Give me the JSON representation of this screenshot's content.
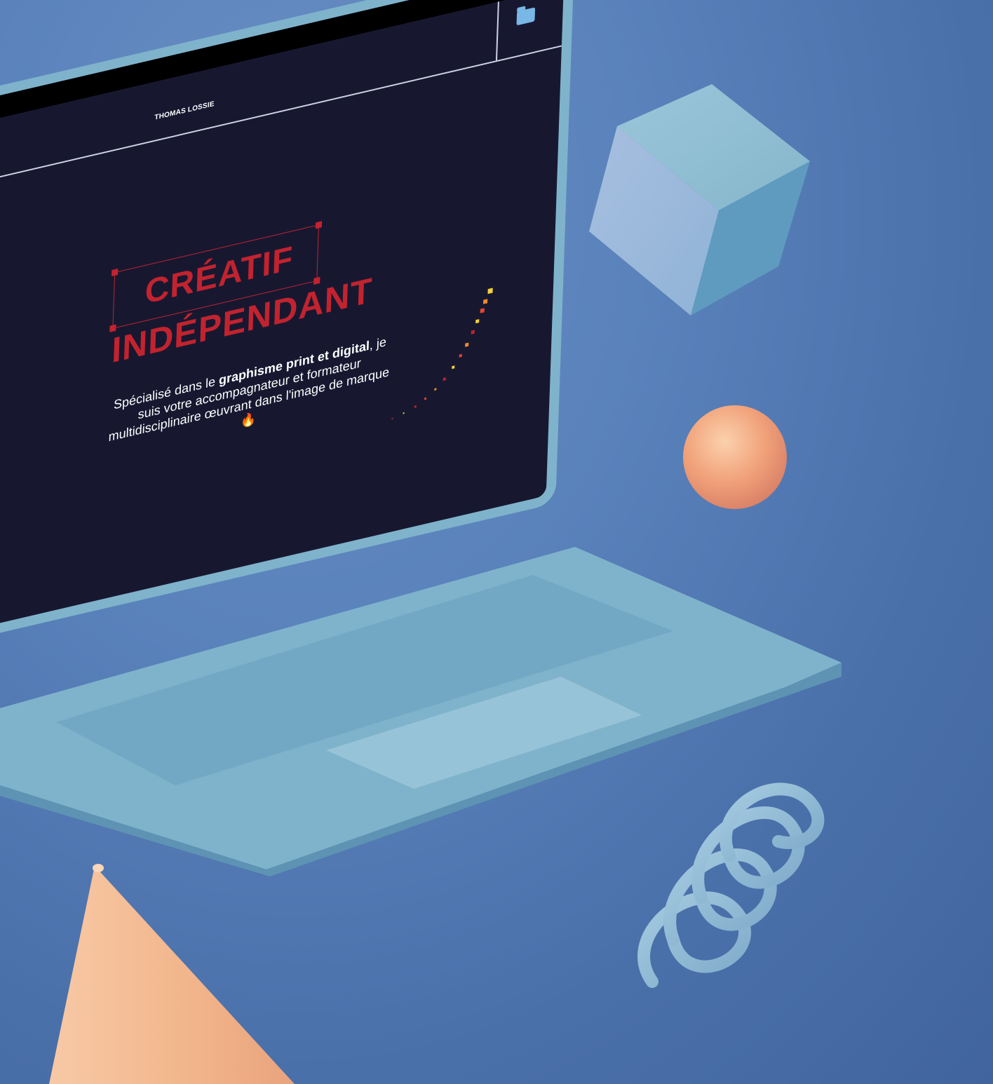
{
  "site": {
    "brand": "THOMAS LOSSIE",
    "headline_line1": "CRÉATIF",
    "headline_line2": "INDÉPENDANT",
    "tagline_prefix": "Spécialisé dans le ",
    "tagline_bold": "graphisme print et digital",
    "tagline_suffix": ", je suis votre accompagnateur et formateur multidisciplinaire œuvrant dans l'image de marque",
    "tagline_emoji": "🔥"
  },
  "colors": {
    "background": "#5a82bb",
    "screen": "#171830",
    "accent_red": "#c2232f",
    "laptop_body": "#7fb3cb",
    "peach": "#f2b48a"
  },
  "icons": [
    "folder-icon"
  ]
}
